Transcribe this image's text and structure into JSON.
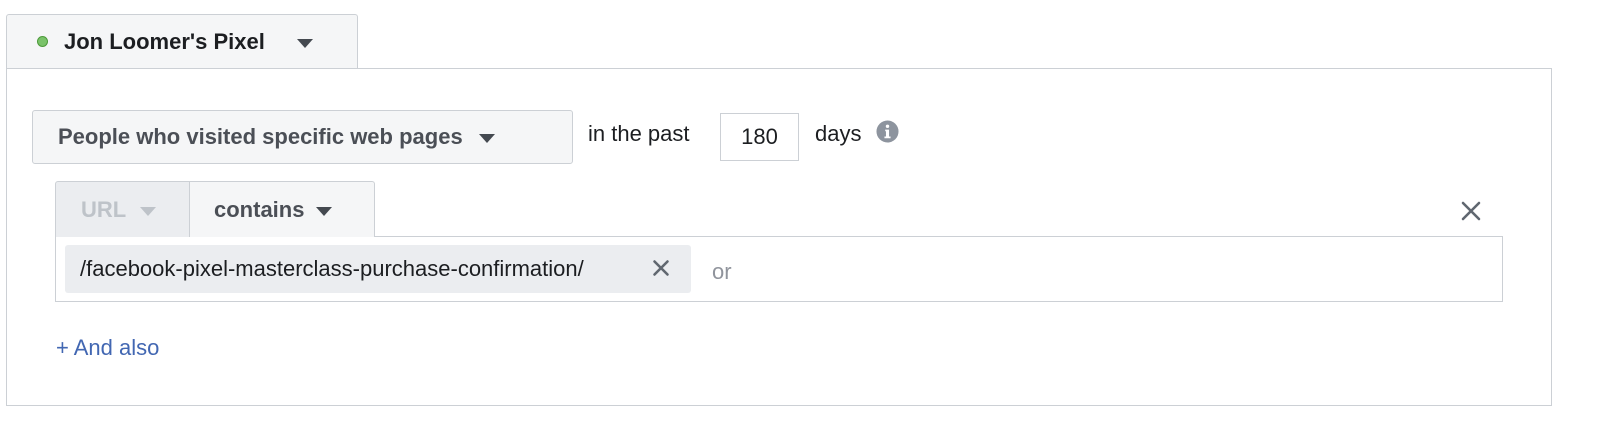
{
  "pixel": {
    "name": "Jon Loomer's Pixel",
    "status_color": "#7ac36a"
  },
  "rule": {
    "audience_type": "People who visited specific web pages",
    "in_the_past_label": "in the past",
    "days_value": "180",
    "days_label": "days",
    "field": "URL",
    "operator": "contains",
    "tokens": [
      "/facebook-pixel-masterclass-purchase-confirmation/"
    ],
    "input_placeholder": "or"
  },
  "actions": {
    "and_also": "+ And also"
  },
  "icons": {
    "info": "info-icon",
    "close": "close-icon",
    "caret": "caret-down-icon"
  },
  "colors": {
    "link": "#4267b2",
    "status_green": "#7ac36a",
    "border": "#ccd0d5"
  }
}
